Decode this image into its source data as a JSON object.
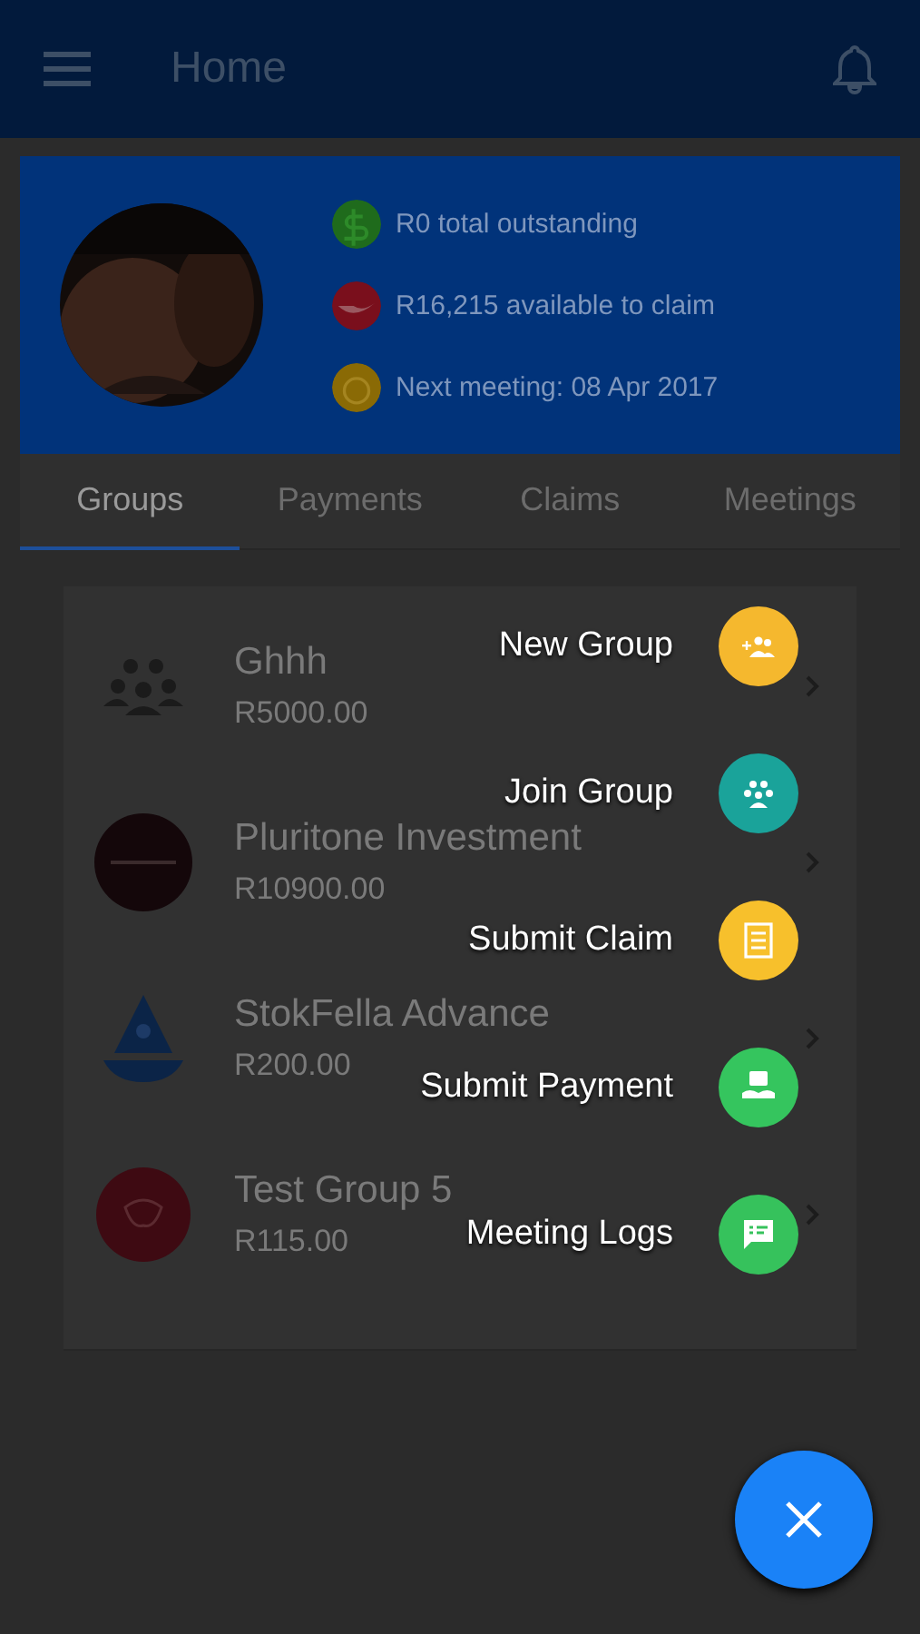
{
  "header": {
    "title": "Home"
  },
  "summary": {
    "items": [
      {
        "text": "R0 total outstanding",
        "color": "#1f6b1c",
        "kind": "dollar"
      },
      {
        "text": "R16,215 available to claim",
        "color": "#7a0f1c",
        "kind": "hand"
      },
      {
        "text": "Next meeting: 08 Apr 2017",
        "color": "#8a6a05",
        "kind": "clock"
      }
    ]
  },
  "tabs": [
    {
      "label": "Groups",
      "selected": true
    },
    {
      "label": "Payments",
      "selected": false
    },
    {
      "label": "Claims",
      "selected": false
    },
    {
      "label": "Meetings",
      "selected": false
    }
  ],
  "groups": [
    {
      "name": "Ghhh",
      "amount": "R5000.00",
      "kind": "people"
    },
    {
      "name": "Pluritone Investment",
      "amount": "R10900.00",
      "kind": "dark-logo"
    },
    {
      "name": "StokFella Advance",
      "amount": "R200.00",
      "kind": "boat"
    },
    {
      "name": "Test Group 5",
      "amount": "R115.00",
      "kind": "red-logo"
    }
  ],
  "fab_menu": [
    {
      "label": "New Group",
      "color": "#f5b82e",
      "kind": "add-group"
    },
    {
      "label": "Join Group",
      "color": "#1aa39a",
      "kind": "group"
    },
    {
      "label": "Submit Claim",
      "color": "#f7c02c",
      "kind": "document"
    },
    {
      "label": "Submit Payment",
      "color": "#35c55e",
      "kind": "payment"
    },
    {
      "label": "Meeting Logs",
      "color": "#36c25c",
      "kind": "chat"
    }
  ],
  "fab": {
    "open": true
  }
}
